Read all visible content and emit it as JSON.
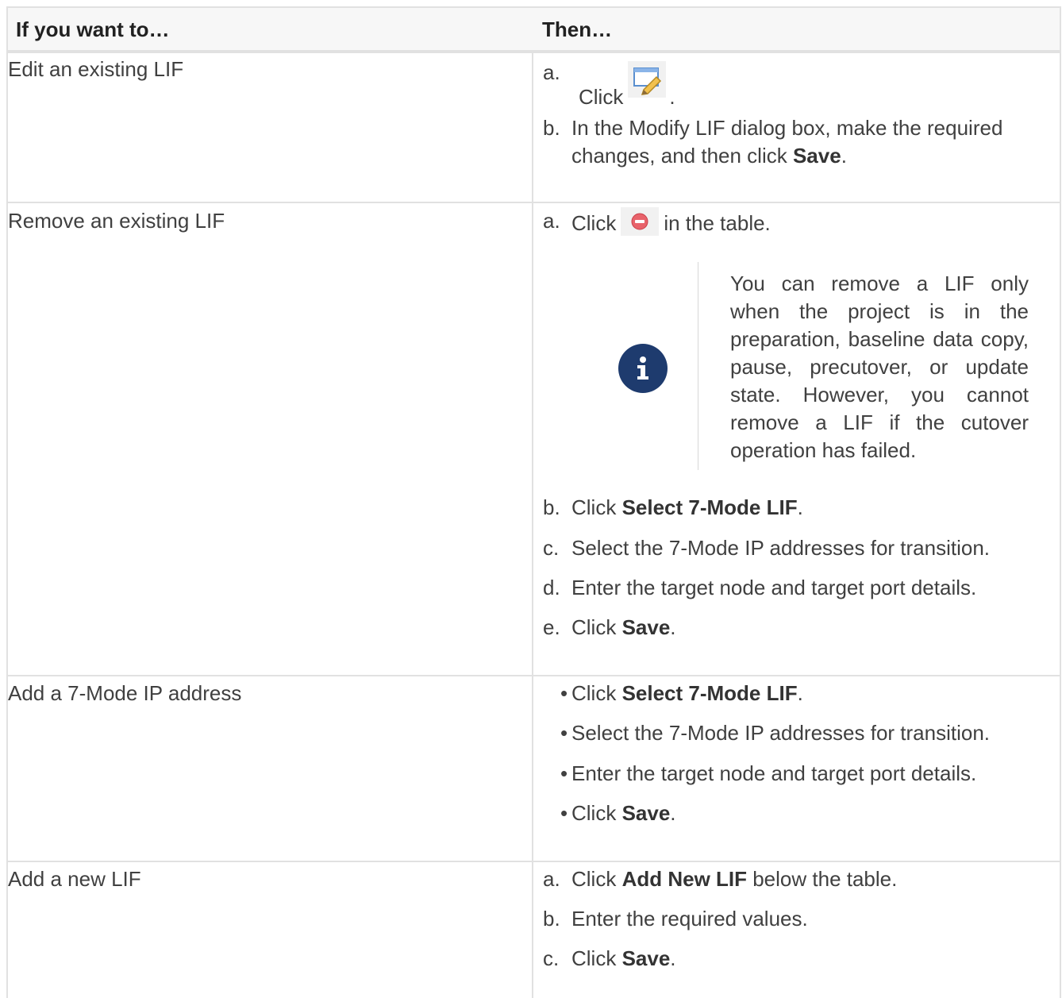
{
  "header": {
    "col1": "If you want to…",
    "col2": "Then…"
  },
  "rows": [
    {
      "action": "Edit an existing LIF",
      "steps": [
        {
          "marker": "a.",
          "text": "Click",
          "after_icon": ".",
          "icon": "edit-pencil-icon"
        },
        {
          "marker": "b.",
          "text_line1": "In the Modify LIF dialog box, make the required",
          "text_line2_pre": "changes, and then click ",
          "text_line2_bold": "Save",
          "text_line2_post": "."
        }
      ]
    },
    {
      "action": "Remove an existing LIF",
      "steps": [
        {
          "marker": "a.",
          "text": "Click",
          "after_icon": "in the table.",
          "icon": "remove-minus-icon"
        },
        {
          "marker": "b.",
          "pre": "Click ",
          "bold": "Select 7-Mode LIF",
          "post": "."
        },
        {
          "marker": "c.",
          "text": "Select the 7-Mode IP addresses for transition."
        },
        {
          "marker": "d.",
          "text": "Enter the target node and target port details."
        },
        {
          "marker": "e.",
          "pre": "Click ",
          "bold": "Save",
          "post": "."
        }
      ],
      "note": "You can remove a LIF only when the project is in the preparation, baseline data copy, pause, precutover, or update state. However, you cannot remove a LIF if the cutover operation has failed.",
      "note_icon": "info-icon"
    },
    {
      "action": "Add a 7-Mode IP address",
      "steps": [
        {
          "marker": "•",
          "pre": "Click ",
          "bold": "Select 7-Mode LIF",
          "post": "."
        },
        {
          "marker": "•",
          "text": "Select the 7-Mode IP addresses for transition."
        },
        {
          "marker": "•",
          "text": "Enter the target node and target port details."
        },
        {
          "marker": "•",
          "pre": "Click ",
          "bold": "Save",
          "post": "."
        }
      ]
    },
    {
      "action": "Add a new LIF",
      "steps": [
        {
          "marker": "a.",
          "pre": "Click ",
          "bold": "Add New LIF",
          "post": " below the table."
        },
        {
          "marker": "b.",
          "text": "Enter the required values."
        },
        {
          "marker": "c.",
          "pre": "Click ",
          "bold": "Save",
          "post": "."
        }
      ]
    }
  ]
}
